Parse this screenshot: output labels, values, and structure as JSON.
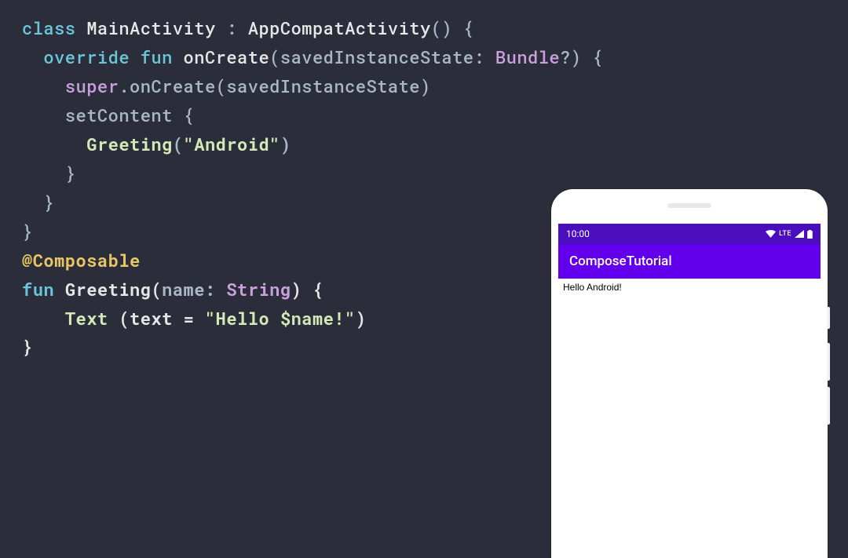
{
  "code": {
    "kw_class": "class",
    "class_name": "MainActivity",
    "colon": " : ",
    "parent_class": "AppCompatActivity",
    "parens1": "()",
    "brace_open": " {",
    "kw_override": "override",
    "kw_fun": "fun",
    "method_onCreate": "onCreate",
    "paren_open": "(",
    "param_saved": "savedInstanceState",
    "colon_type": ": ",
    "type_bundle": "Bundle",
    "qmark": "?",
    "paren_close": ")",
    "super_kw": "super",
    "dot": ".",
    "onCreate_call": "onCreate",
    "super_arg": "(savedInstanceState)",
    "setContent": "setContent",
    "brace_open2": " {",
    "greeting_call": "Greeting",
    "greeting_arg_open": "(",
    "greeting_arg_str": "\"Android\"",
    "greeting_arg_close": ")",
    "brace_close": "}",
    "annotation": "@Composable",
    "fun2_name": "Greeting",
    "param_name": "name",
    "type_string": "String",
    "text_call": "Text",
    "text_arg_open": " (text = ",
    "text_arg_str": "\"Hello $name!\"",
    "text_arg_close": ")"
  },
  "phone": {
    "time": "10:00",
    "lte": "LTE",
    "app_title": "ComposeTutorial",
    "body_text": "Hello Android!"
  }
}
